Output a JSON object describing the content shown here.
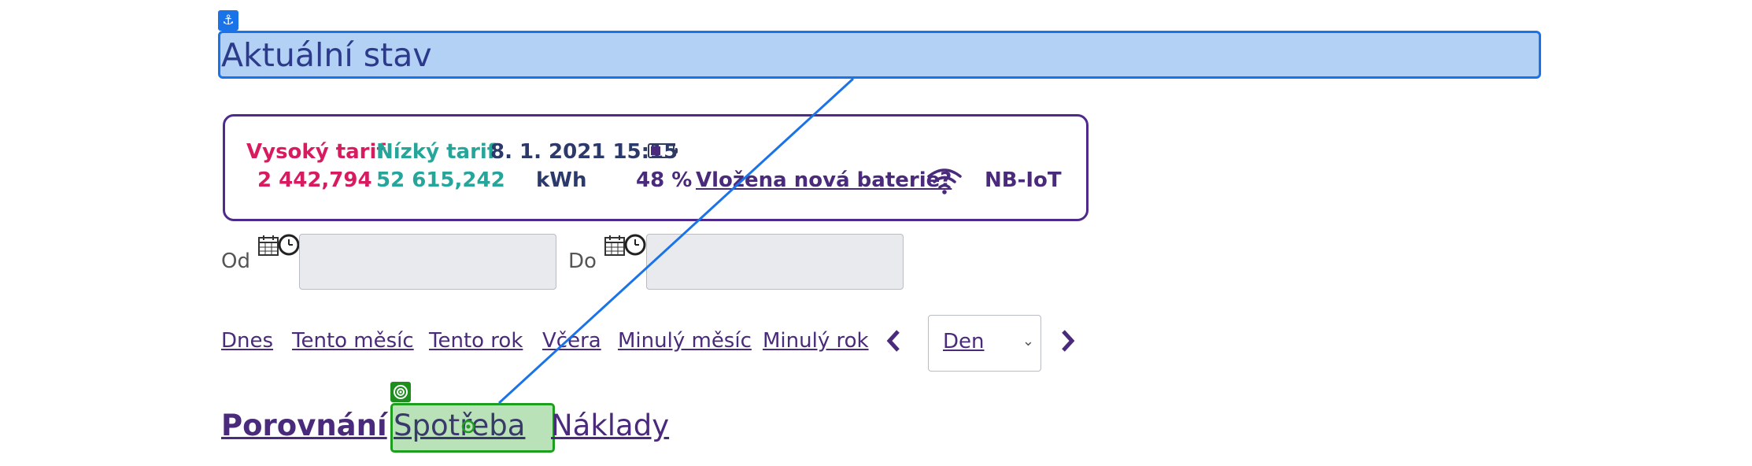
{
  "page": {
    "title": "Aktuální stav"
  },
  "meter": {
    "high_tariff_label": "Vysoký tarif",
    "high_tariff_value": "2 442,794",
    "low_tariff_label": "Nízký tarif",
    "low_tariff_value": "52 615,242",
    "datetime": "8. 1. 2021 15:15",
    "unit": "kWh",
    "battery_percent": "48 %",
    "battery_level": 0.48,
    "new_battery_link": "Vložena nová baterie?",
    "network": "NB-IoT"
  },
  "range": {
    "from_label": "Od",
    "to_label": "Do",
    "from_value": "",
    "to_value": ""
  },
  "quick_links": [
    "Dnes",
    "Tento měsíc",
    "Tento rok",
    "Včera",
    "Minulý měsíc",
    "Minulý rok"
  ],
  "granularity": {
    "selected": "Den"
  },
  "tabs": [
    "Porovnání",
    "Spotřeba",
    "Náklady"
  ],
  "colors": {
    "accent_purple": "#4a2a7a",
    "high_tariff": "#d81b60",
    "low_tariff": "#26a69a",
    "highlight_blue": "#1a73e8",
    "highlight_green": "#1e9e1e"
  },
  "icons": {
    "anchor": "anchor-icon",
    "battery": "battery-icon",
    "wifi": "wifi-icon",
    "calendar": "calendar-clock-icon",
    "prev": "chevron-left-icon",
    "next": "chevron-right-icon",
    "select": "chevron-down-icon",
    "target": "target-icon"
  }
}
